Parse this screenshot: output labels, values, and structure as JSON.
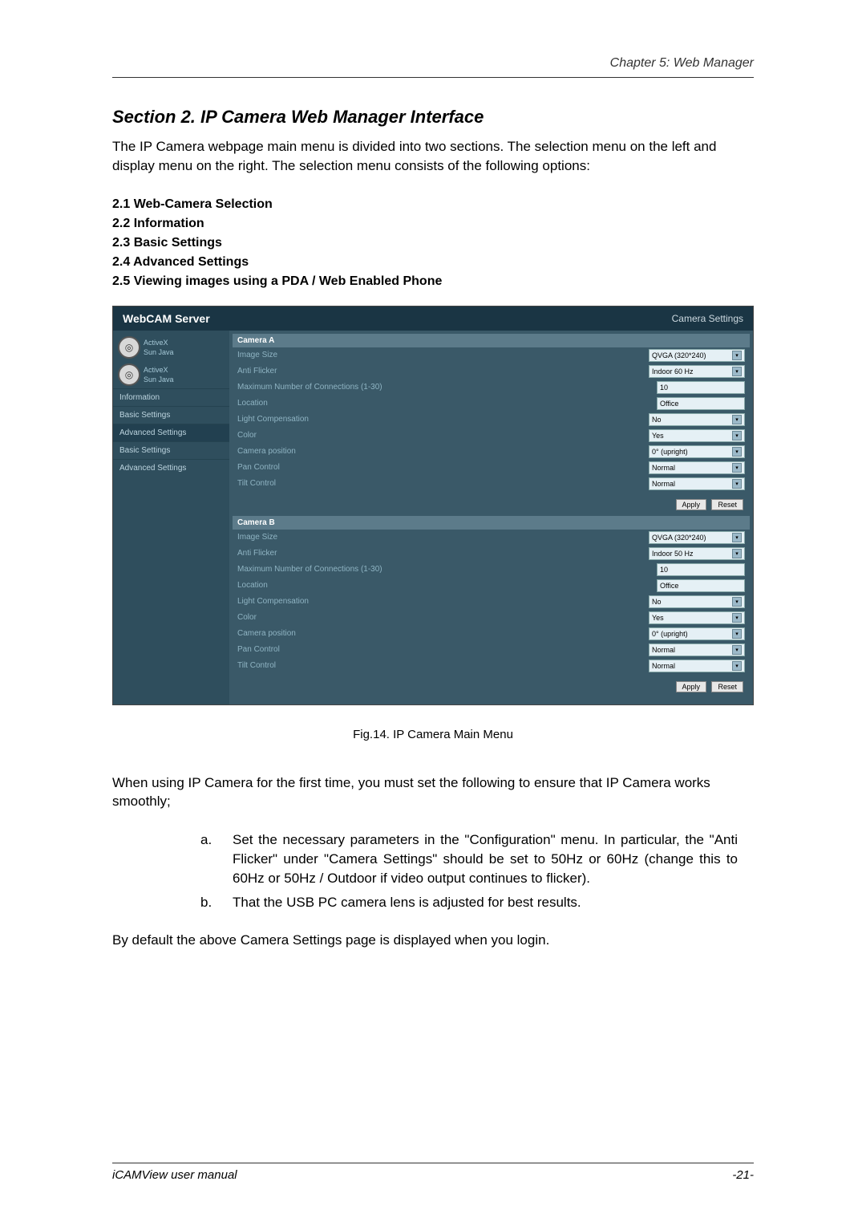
{
  "header": {
    "chapter": "Chapter 5: Web Manager"
  },
  "section_title": "Section 2. IP Camera Web Manager Interface",
  "intro": "The IP Camera webpage main menu is divided into two sections. The selection menu on the left and display menu on the right. The selection menu consists of the following options:",
  "subsections": [
    "2.1 Web-Camera Selection",
    "2.2 Information",
    "2.3 Basic Settings",
    "2.4 Advanced Settings",
    "2.5 Viewing images using a PDA / Web Enabled Phone"
  ],
  "screenshot": {
    "title": "WebCAM Server",
    "title_right": "Camera Settings",
    "sidebar": {
      "camA": {
        "activex": "ActiveX",
        "java": "Sun Java"
      },
      "camB": {
        "activex": "ActiveX",
        "java": "Sun Java"
      },
      "links": [
        "Information",
        "Basic Settings",
        "Advanced Settings",
        "Basic Settings",
        "Advanced Settings"
      ]
    },
    "cameraA": {
      "header": "Camera A",
      "rows": [
        {
          "label": "Image Size",
          "value": "QVGA (320*240)",
          "type": "select"
        },
        {
          "label": "Anti Flicker",
          "value": "Indoor 60 Hz",
          "type": "select"
        },
        {
          "label": "Maximum Number of Connections (1-30)",
          "value": "10",
          "type": "text"
        },
        {
          "label": "Location",
          "value": "Office",
          "type": "text"
        },
        {
          "label": "Light Compensation",
          "value": "No",
          "type": "select"
        },
        {
          "label": "Color",
          "value": "Yes",
          "type": "select"
        },
        {
          "label": "Camera position",
          "value": "0° (upright)",
          "type": "select"
        },
        {
          "label": "Pan Control",
          "value": "Normal",
          "type": "select"
        },
        {
          "label": "Tilt Control",
          "value": "Normal",
          "type": "select"
        }
      ]
    },
    "cameraB": {
      "header": "Camera B",
      "rows": [
        {
          "label": "Image Size",
          "value": "QVGA (320*240)",
          "type": "select"
        },
        {
          "label": "Anti Flicker",
          "value": "Indoor 50 Hz",
          "type": "select"
        },
        {
          "label": "Maximum Number of Connections (1-30)",
          "value": "10",
          "type": "text"
        },
        {
          "label": "Location",
          "value": "Office",
          "type": "text"
        },
        {
          "label": "Light Compensation",
          "value": "No",
          "type": "select"
        },
        {
          "label": "Color",
          "value": "Yes",
          "type": "select"
        },
        {
          "label": "Camera position",
          "value": "0° (upright)",
          "type": "select"
        },
        {
          "label": "Pan Control",
          "value": "Normal",
          "type": "select"
        },
        {
          "label": "Tilt Control",
          "value": "Normal",
          "type": "select"
        }
      ]
    },
    "buttons": {
      "apply": "Apply",
      "reset": "Reset"
    }
  },
  "figure_caption": "Fig.14.  IP Camera Main Menu",
  "text2": "When using IP Camera for the first time, you must set the following to ensure that IP Camera works smoothly;",
  "list": [
    {
      "letter": "a.",
      "text": "Set the necessary parameters in the \"Configuration\" menu. In particular, the \"Anti Flicker\" under \"Camera Settings\" should be set to 50Hz or 60Hz (change this to 60Hz or 50Hz / Outdoor if video output continues to flicker)."
    },
    {
      "letter": "b.",
      "text": "That the USB PC camera lens is adjusted for best results."
    }
  ],
  "text3": "By default the above Camera Settings page is displayed when you login.",
  "footer": {
    "left": "iCAMView  user  manual",
    "right": "-21-"
  }
}
